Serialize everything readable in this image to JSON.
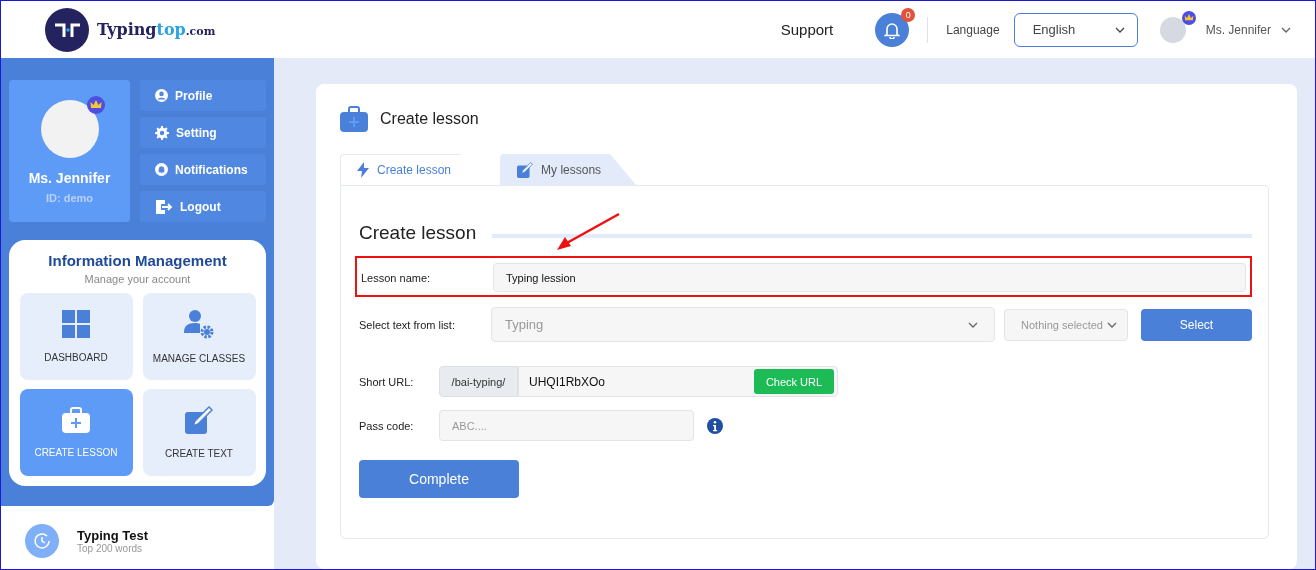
{
  "header": {
    "logo": {
      "name": "Typing",
      "accent": "top",
      "suffix": ".com"
    },
    "support": "Support",
    "notifications": {
      "count": "0"
    },
    "language_label": "Language",
    "language": {
      "value": "English"
    },
    "user": {
      "name": "Ms. Jennifer",
      "premium": true
    }
  },
  "profile": {
    "name": "Ms. Jennifer",
    "id": "ID: demo",
    "premium": true
  },
  "account_menu": [
    {
      "label": "Profile"
    },
    {
      "label": "Setting"
    },
    {
      "label": "Notifications"
    },
    {
      "label": "Logout"
    }
  ],
  "info_panel": {
    "title": "Information Management",
    "subtitle": "Manage your account",
    "tiles": [
      {
        "label": "DASHBOARD",
        "selected": false
      },
      {
        "label": "MANAGE CLASSES",
        "selected": false
      },
      {
        "label": "CREATE LESSON",
        "selected": true
      },
      {
        "label": "CREATE TEXT",
        "selected": false
      }
    ]
  },
  "sidebar_items": [
    {
      "title": "Typing Test",
      "subtitle": "Top 200 words"
    }
  ],
  "page": {
    "title": "Create lesson",
    "tabs": [
      {
        "label": "Create lesson",
        "selected": true
      },
      {
        "label": "My lessons",
        "selected": false
      }
    ],
    "form": {
      "heading": "Create lesson",
      "lesson_name": {
        "label": "Lesson name:",
        "value": "Typing lession",
        "highlighted": true
      },
      "text_select": {
        "label": "Select text from list:",
        "placeholder": "Typing",
        "filter": "Nothing selected",
        "button": "Select"
      },
      "short_url": {
        "label": "Short URL:",
        "prefix": "/bai-typing/",
        "value": "UHQI1RbXOo",
        "button": "Check URL"
      },
      "pass_code": {
        "label": "Pass code:",
        "placeholder": "ABC...."
      },
      "submit": "Complete"
    }
  }
}
